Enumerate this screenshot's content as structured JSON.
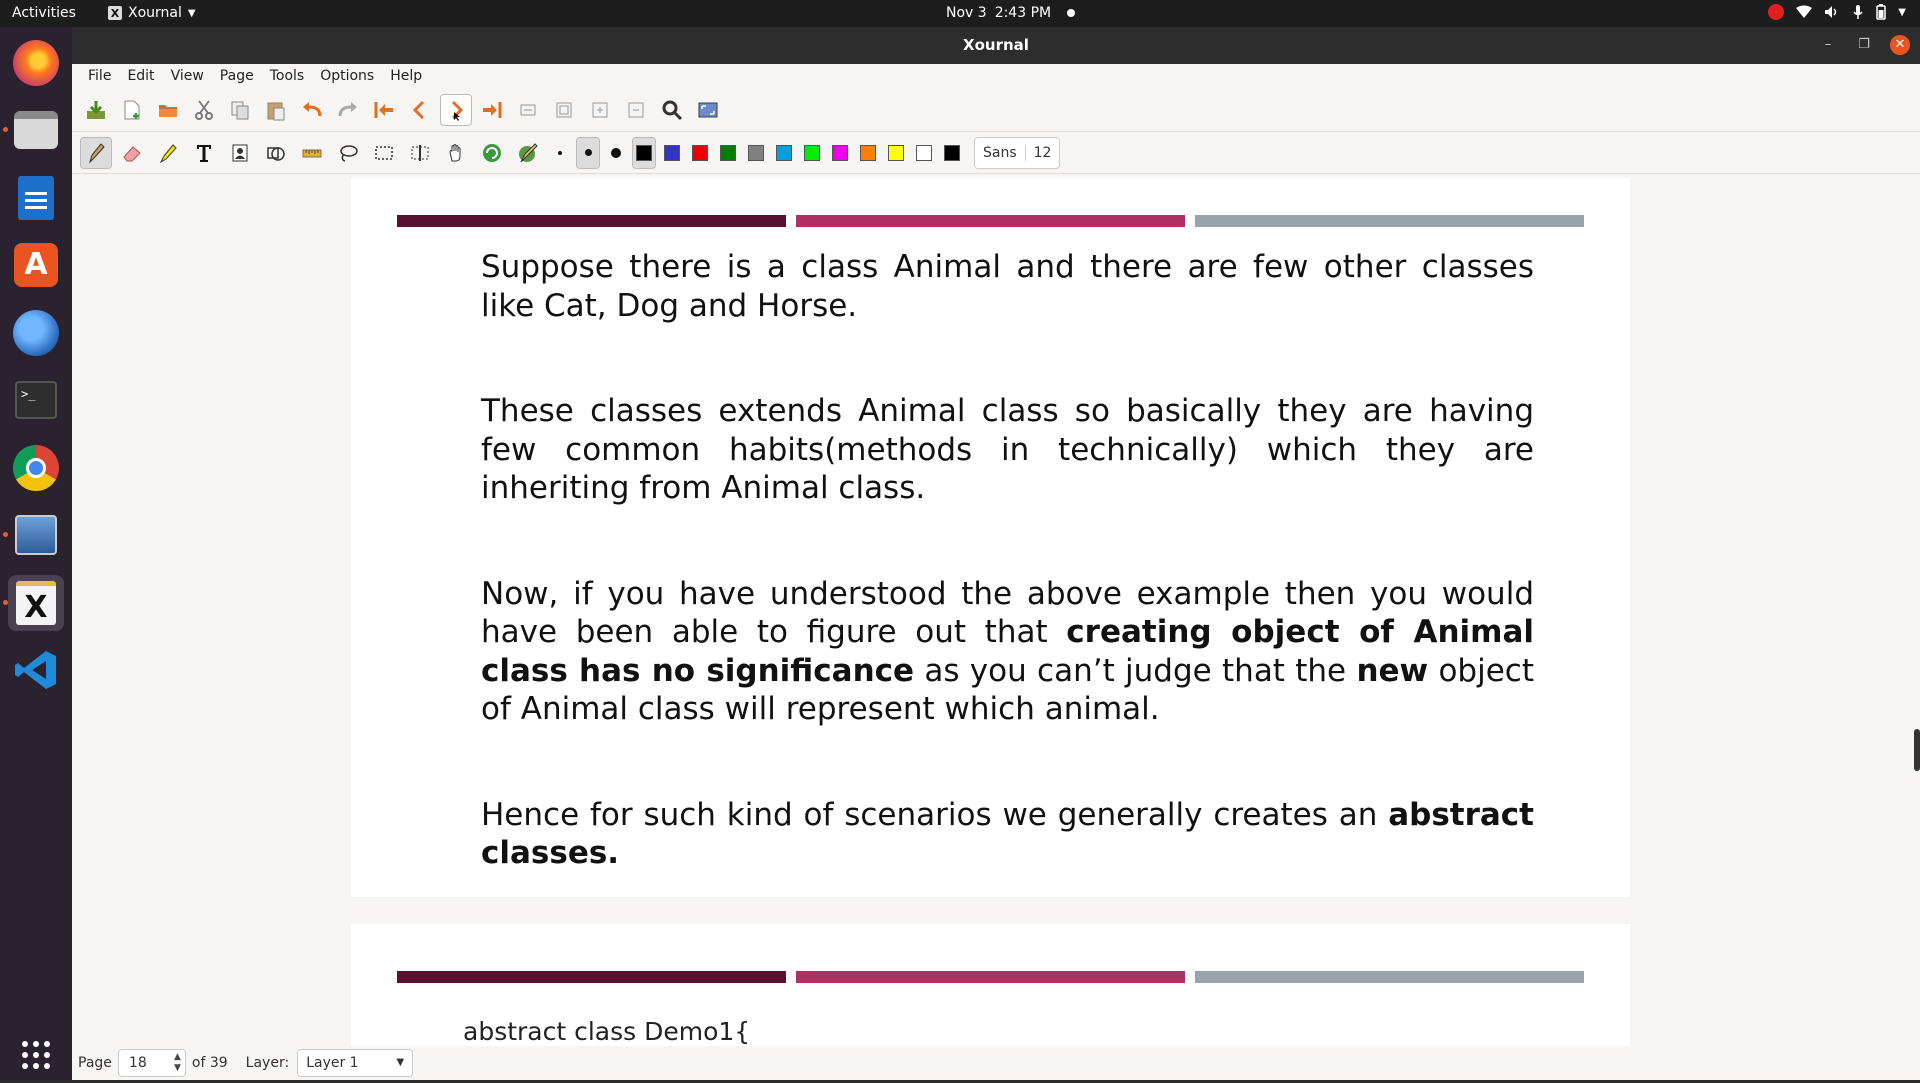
{
  "topbar": {
    "activities": "Activities",
    "app_name": "Xournal",
    "date": "Nov 3",
    "time": "2:43 PM"
  },
  "dock": {
    "items": [
      "firefox-icon",
      "files-icon",
      "writer-icon",
      "software-icon",
      "thunderbird-icon",
      "terminal-icon",
      "chrome-icon",
      "screenshot-icon",
      "xournal-icon",
      "vscode-icon",
      "app-grid-icon"
    ]
  },
  "window": {
    "title": "Xournal"
  },
  "menu": {
    "file": "File",
    "edit": "Edit",
    "view": "View",
    "page": "Page",
    "tools": "Tools",
    "options": "Options",
    "help": "Help"
  },
  "toolbar": {
    "font_name": "Sans",
    "font_size": "12",
    "colors": [
      "#000000",
      "#3333cc",
      "#ee0000",
      "#008000",
      "#808080",
      "#00a0e0",
      "#00ee00",
      "#ee00ee",
      "#ff8000",
      "#ffff00",
      "#ffffff",
      "#000000"
    ]
  },
  "page1": {
    "bar_colors": [
      "#5a1030",
      "#b03064",
      "#9aa3ab"
    ],
    "para1": "Suppose there is a class Animal and there are few other classes like Cat, Dog and Horse.",
    "para2": "These classes extends Animal class so basically they are having few common habits(methods in technically) which they are inheriting from Animal class.",
    "para3_a": "Now, if you have understood the above example then you would have been able to figure out that ",
    "para3_b": "creating object of Animal class has no significance",
    "para3_c": " as you can’t judge that the ",
    "para3_d": "new",
    "para3_e": " object of Animal class will represent which animal.",
    "para4_a": "Hence for such kind of scenarios we generally creates an ",
    "para4_b": "abstract classes."
  },
  "page2": {
    "code_line": "abstract class Demo1{"
  },
  "status": {
    "page_label": "Page",
    "page_value": "18",
    "of_label": "of 39",
    "layer_label": "Layer:",
    "layer_value": "Layer 1"
  }
}
